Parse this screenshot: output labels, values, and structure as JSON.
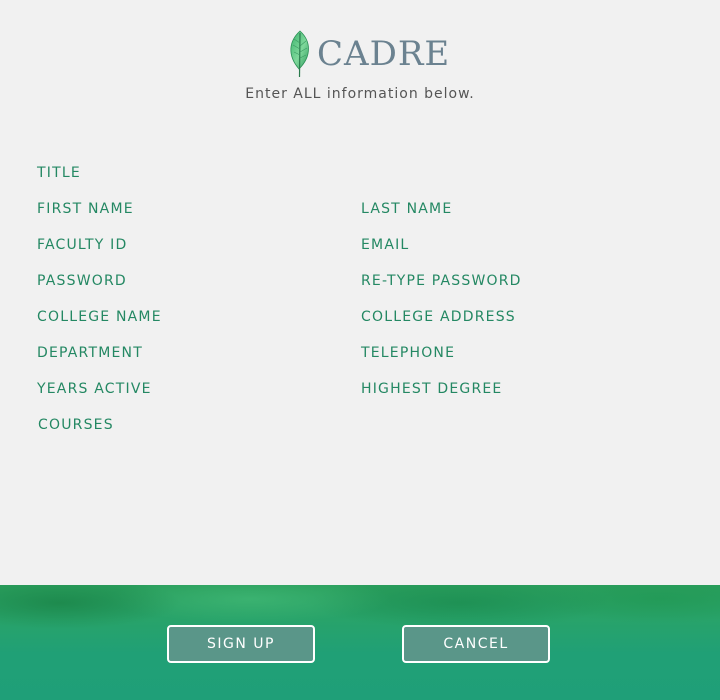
{
  "header": {
    "logo_text": "CADRE",
    "logo_icon": "leaf-icon",
    "subtitle": "Enter ALL information below."
  },
  "form": {
    "fields": {
      "title": "TITLE",
      "first_name": "FIRST NAME",
      "last_name": "LAST NAME",
      "faculty_id": "FACULTY ID",
      "email": "EMAIL",
      "password": "PASSWORD",
      "retype_password": "RE-TYPE PASSWORD",
      "college_name": "COLLEGE NAME",
      "college_address": "COLLEGE ADDRESS",
      "department": "DEPARTMENT",
      "telephone": "TELEPHONE",
      "years_active": "YEARS ACTIVE",
      "highest_degree": "HIGHEST DEGREE",
      "courses": "COURSES"
    }
  },
  "footer": {
    "sign_up_label": "SIGN UP",
    "cancel_label": "CANCEL"
  },
  "colors": {
    "label_green": "#248863",
    "logo_gray": "#6b8290",
    "button_fill": "#5a9689",
    "footer_green": "#20a076"
  }
}
